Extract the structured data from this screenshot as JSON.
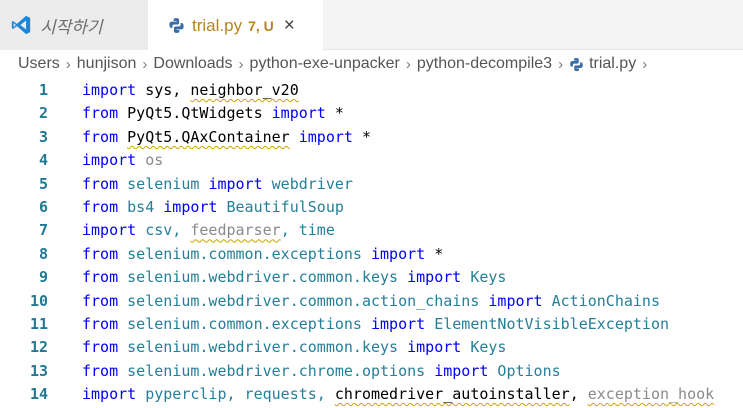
{
  "tabs": {
    "welcome": {
      "label": "시작하기"
    },
    "file": {
      "label": "trial.py",
      "status": "7, U",
      "close_glyph": "×"
    }
  },
  "breadcrumb": {
    "items": [
      "Users",
      "hunjison",
      "Downloads",
      "python-exe-unpacker",
      "python-decompile3",
      "trial.py"
    ],
    "separator": "›"
  },
  "colors": {
    "keyword": "#0000ff",
    "module": "#267f99",
    "line_number": "#237893",
    "warning": "#b5871a"
  },
  "code_lines": [
    {
      "n": "1",
      "tokens": [
        {
          "t": "import",
          "c": "kw"
        },
        {
          "t": " sys, ",
          "c": "plain"
        },
        {
          "t": "neighbor_v20",
          "c": "plain",
          "squig": true
        }
      ]
    },
    {
      "n": "2",
      "tokens": [
        {
          "t": "from",
          "c": "kw"
        },
        {
          "t": " PyQt5.QtWidgets ",
          "c": "plain"
        },
        {
          "t": "import",
          "c": "kw"
        },
        {
          "t": " *",
          "c": "plain"
        }
      ]
    },
    {
      "n": "3",
      "tokens": [
        {
          "t": "from",
          "c": "kw"
        },
        {
          "t": " ",
          "c": "plain"
        },
        {
          "t": "PyQt5.QAxContainer",
          "c": "plain",
          "squig": true
        },
        {
          "t": " ",
          "c": "plain"
        },
        {
          "t": "import",
          "c": "kw"
        },
        {
          "t": " *",
          "c": "plain"
        }
      ]
    },
    {
      "n": "4",
      "tokens": [
        {
          "t": "import",
          "c": "kw"
        },
        {
          "t": " ",
          "c": "plain"
        },
        {
          "t": "os",
          "c": "faded"
        }
      ]
    },
    {
      "n": "5",
      "tokens": [
        {
          "t": "from",
          "c": "kw"
        },
        {
          "t": " selenium ",
          "c": "mod"
        },
        {
          "t": "import",
          "c": "kw"
        },
        {
          "t": " webdriver",
          "c": "mod"
        }
      ]
    },
    {
      "n": "6",
      "tokens": [
        {
          "t": "from",
          "c": "kw"
        },
        {
          "t": " bs4 ",
          "c": "mod"
        },
        {
          "t": "import",
          "c": "kw"
        },
        {
          "t": " BeautifulSoup",
          "c": "mod"
        }
      ]
    },
    {
      "n": "7",
      "tokens": [
        {
          "t": "import",
          "c": "kw"
        },
        {
          "t": " csv, ",
          "c": "mod"
        },
        {
          "t": "feedparser",
          "c": "faded",
          "squig": true
        },
        {
          "t": ", time",
          "c": "mod"
        }
      ]
    },
    {
      "n": "8",
      "tokens": [
        {
          "t": "from",
          "c": "kw"
        },
        {
          "t": " selenium.common.exceptions ",
          "c": "mod"
        },
        {
          "t": "import",
          "c": "kw"
        },
        {
          "t": " *",
          "c": "plain"
        }
      ]
    },
    {
      "n": "9",
      "tokens": [
        {
          "t": "from",
          "c": "kw"
        },
        {
          "t": " selenium.webdriver.common.keys ",
          "c": "mod"
        },
        {
          "t": "import",
          "c": "kw"
        },
        {
          "t": " Keys",
          "c": "mod"
        }
      ]
    },
    {
      "n": "10",
      "tokens": [
        {
          "t": "from",
          "c": "kw"
        },
        {
          "t": " selenium.webdriver.common.action_chains ",
          "c": "mod"
        },
        {
          "t": "import",
          "c": "kw"
        },
        {
          "t": " ActionChains",
          "c": "mod"
        }
      ]
    },
    {
      "n": "11",
      "tokens": [
        {
          "t": "from",
          "c": "kw"
        },
        {
          "t": " selenium.common.exceptions ",
          "c": "mod"
        },
        {
          "t": "import",
          "c": "kw"
        },
        {
          "t": " ElementNotVisibleException",
          "c": "mod"
        }
      ]
    },
    {
      "n": "12",
      "tokens": [
        {
          "t": "from",
          "c": "kw"
        },
        {
          "t": " selenium.webdriver.common.keys ",
          "c": "mod"
        },
        {
          "t": "import",
          "c": "kw"
        },
        {
          "t": " Keys",
          "c": "mod"
        }
      ]
    },
    {
      "n": "13",
      "tokens": [
        {
          "t": "from",
          "c": "kw"
        },
        {
          "t": " selenium.webdriver.chrome.options ",
          "c": "mod"
        },
        {
          "t": "import",
          "c": "kw"
        },
        {
          "t": " Options",
          "c": "mod"
        }
      ]
    },
    {
      "n": "14",
      "tokens": [
        {
          "t": "import",
          "c": "kw"
        },
        {
          "t": " pyperclip, requests, ",
          "c": "mod"
        },
        {
          "t": "chromedriver_autoinstaller",
          "c": "plain",
          "squig": true
        },
        {
          "t": ", ",
          "c": "plain"
        },
        {
          "t": "exception_hook",
          "c": "faded",
          "squig": true
        }
      ]
    }
  ]
}
